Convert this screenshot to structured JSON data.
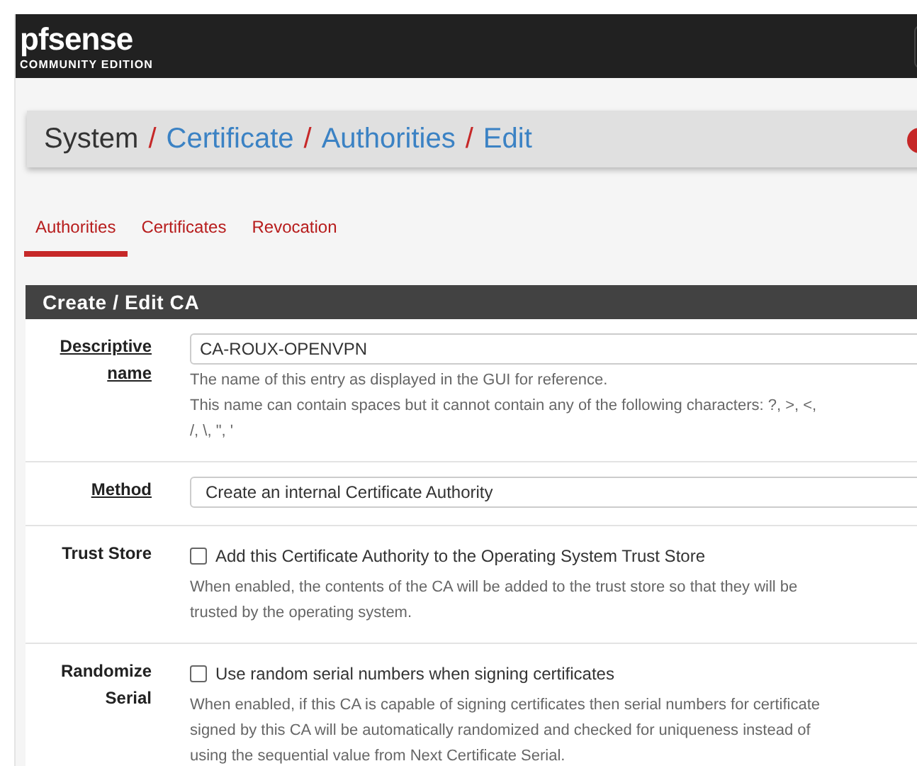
{
  "navbar": {
    "logo": "pfsense",
    "edition": "COMMUNITY EDITION"
  },
  "breadcrumb": [
    {
      "label": "System",
      "link": false,
      "separator": "/"
    },
    {
      "label": "Certificate",
      "link": true,
      "separator": "/"
    },
    {
      "label": "Authorities",
      "link": true,
      "separator": "/"
    },
    {
      "label": "Edit",
      "link": true
    }
  ],
  "tabs": [
    {
      "label": "Authorities",
      "selected": true
    },
    {
      "label": "Certificates",
      "selected": false
    },
    {
      "label": "Revocation",
      "selected": false
    }
  ],
  "panel": {
    "title": "Create / Edit CA"
  },
  "rows": [
    {
      "kind": "text",
      "label": [
        "Descriptive",
        "name"
      ],
      "underlined": true,
      "value": "CA-ROUX-OPENVPN",
      "help": [
        "The name of this entry as displayed in the GUI for reference.",
        "This name can contain spaces but it cannot contain any of the following characters: ?, >, <,",
        "/, \\, \", '"
      ]
    },
    {
      "kind": "select",
      "label": [
        "Method"
      ],
      "underlined": true,
      "value": "Create an internal Certificate Authority",
      "help": []
    },
    {
      "kind": "checkbox",
      "label": [
        "Trust Store"
      ],
      "underlined": false,
      "value": "Add this Certificate Authority to the Operating System Trust Store",
      "checked": false,
      "help": [
        "When enabled, the contents of the CA will be added to the trust store so that they will be",
        "trusted by the operating system."
      ]
    },
    {
      "kind": "checkbox",
      "label": [
        "Randomize",
        "Serial"
      ],
      "underlined": false,
      "value": "Use random serial numbers when signing certificates",
      "checked": false,
      "help": [
        "When enabled, if this CA is capable of signing certificates then serial numbers for certificate",
        "signed by this CA will be automatically randomized and checked for uniqueness instead of",
        "using the sequential value from Next Certificate Serial."
      ]
    }
  ]
}
